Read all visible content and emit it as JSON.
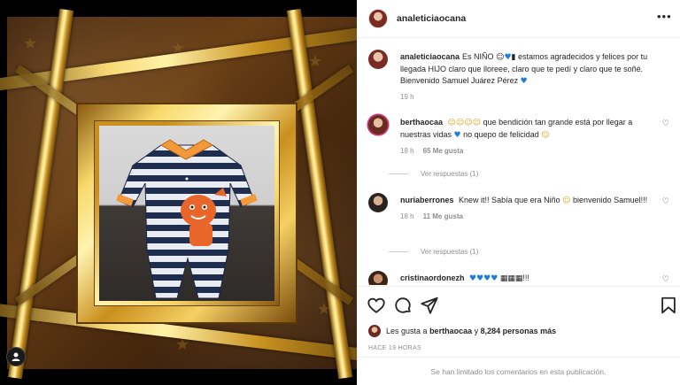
{
  "post": {
    "username": "analeticiaocana",
    "more_icon": "more-options-icon"
  },
  "caption": {
    "username": "analeticiaocana",
    "text_parts": {
      "t1": "Es NIÑO",
      "t2": "estamos agradecidos y felices por tu llegada HIJO claro que lloreee, claro que te pedí y claro que te soñé. Bienvenido Samuel Juárez Pérez"
    },
    "time": "19 h"
  },
  "comments": [
    {
      "username": "berthaocaa",
      "text_a": "que bendición tan grande está por llegar a nuestras vidas",
      "text_b": "no quepo de felicidad",
      "time": "18 h",
      "likes": "65 Me gusta",
      "replies": "Ver respuestas (1)"
    },
    {
      "username": "nuriaberrones",
      "text_a": "Knew it!! Sabía que era Niño",
      "text_b": "bienvenido Samuel!!!",
      "time": "18 h",
      "likes": "11 Me gusta",
      "replies": "Ver respuestas (1)"
    },
    {
      "username": "cristinaordonezh",
      "text_a": "!!!"
    }
  ],
  "likes_summary": {
    "prefix": "Les gusta a",
    "user": "berthaocaa",
    "joiner": "y",
    "others": "8,284 personas más"
  },
  "timestamp": "HACE 19 HORAS",
  "comments_limited": "Se han limitado los comentarios en esta publicación.",
  "colors": {
    "accent_blue": "#0095f6",
    "heart_blue": "#1c7ed6",
    "text_primary": "#262626",
    "text_secondary": "#8e8e8e"
  }
}
